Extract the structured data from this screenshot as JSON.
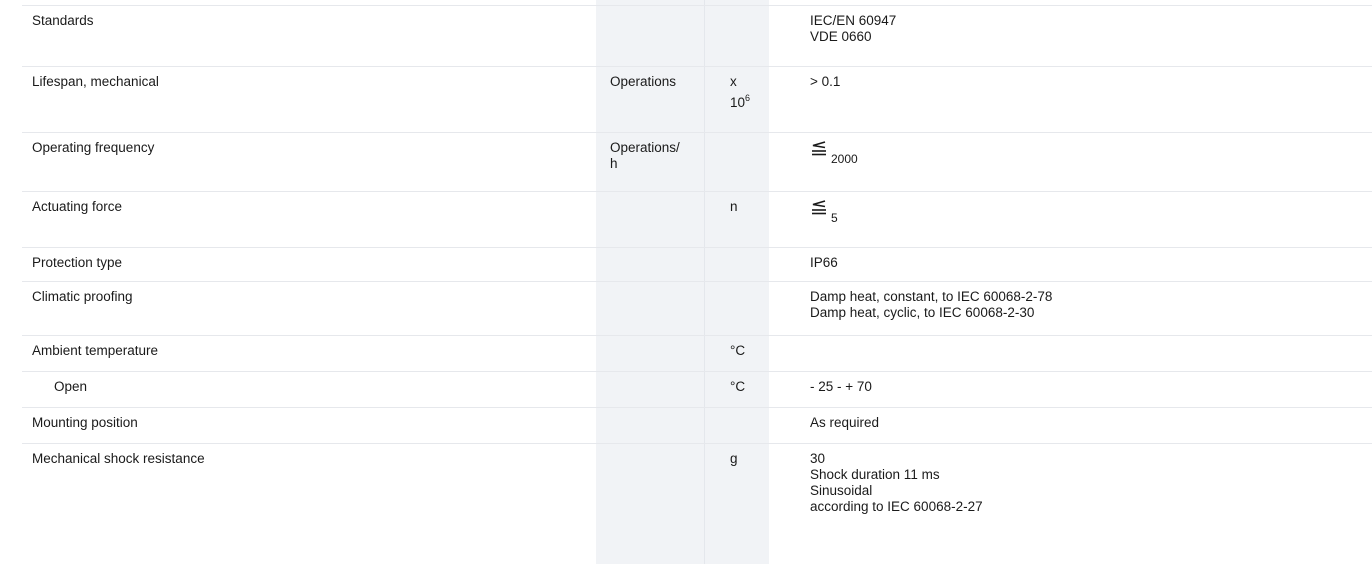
{
  "rows": [
    {
      "label": "Standards",
      "unit": "",
      "unit_line2": "",
      "mult": "",
      "mult_exp": "",
      "values": [
        "IEC/EN 60947",
        "VDE 0660"
      ]
    },
    {
      "label": "Lifespan, mechanical",
      "unit": "Operations",
      "unit_line2": "",
      "mult": "x",
      "mult_base": "10",
      "mult_exp": "6",
      "values": [
        "> 0.1"
      ]
    },
    {
      "label": "Operating frequency",
      "unit": "Operations/",
      "unit_line2": "h",
      "mult": "",
      "mult_exp": "",
      "value_symbol": "less-or-equal-icon",
      "value_sub": "2000"
    },
    {
      "label": "Actuating force",
      "unit": "",
      "unit_line2": "",
      "mult": "n",
      "mult_exp": "",
      "value_symbol": "less-or-equal-icon",
      "value_sub": "5"
    },
    {
      "label": "Protection type",
      "unit": "",
      "unit_line2": "",
      "mult": "",
      "mult_exp": "",
      "values": [
        "IP66"
      ]
    },
    {
      "label": "Climatic proofing",
      "unit": "",
      "unit_line2": "",
      "mult": "",
      "mult_exp": "",
      "values": [
        "Damp heat, constant, to IEC 60068-2-78",
        "Damp heat, cyclic, to IEC 60068-2-30"
      ]
    },
    {
      "label": "Ambient temperature",
      "unit": "",
      "unit_line2": "",
      "mult": "°C",
      "mult_exp": "",
      "values": []
    },
    {
      "label": "Open",
      "unit": "",
      "unit_line2": "",
      "mult": "°C",
      "mult_exp": "",
      "values": [
        "- 25 - + 70"
      ]
    },
    {
      "label": "Mounting position",
      "unit": "",
      "unit_line2": "",
      "mult": "",
      "mult_exp": "",
      "values": [
        "As required"
      ]
    },
    {
      "label": "Mechanical shock resistance",
      "unit": "",
      "unit_line2": "",
      "mult": "g",
      "mult_exp": "",
      "values": [
        "30",
        "Shock duration 11 ms",
        "Sinusoidal",
        "according to IEC 60068-2-27"
      ]
    }
  ],
  "colors": {
    "shade": "#f1f3f6",
    "rule": "#e6e8ec",
    "text": "#1a1a1a"
  }
}
